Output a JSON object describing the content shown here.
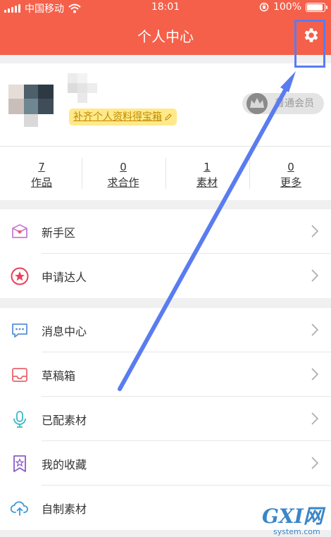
{
  "status_bar": {
    "carrier": "中国移动",
    "time": "18:01",
    "battery": "100%",
    "battery_level": 1.0
  },
  "nav": {
    "title": "个人中心"
  },
  "profile": {
    "promo_text": "补齐个人资料得宝箱",
    "member_label": "普通会员"
  },
  "stats": [
    {
      "num": "7",
      "label": "作品"
    },
    {
      "num": "0",
      "label": "求合作"
    },
    {
      "num": "1",
      "label": "素材"
    },
    {
      "num": "0",
      "label": "更多"
    }
  ],
  "menu": {
    "group1": [
      {
        "label": "新手区",
        "icon": "gift-box-icon"
      },
      {
        "label": "申请达人",
        "icon": "star-badge-icon"
      }
    ],
    "group2": [
      {
        "label": "消息中心",
        "icon": "chat-bubble-icon"
      },
      {
        "label": "草稿箱",
        "icon": "inbox-icon"
      },
      {
        "label": "已配素材",
        "icon": "microphone-icon"
      },
      {
        "label": "我的收藏",
        "icon": "bookmark-star-icon"
      },
      {
        "label": "自制素材",
        "icon": "cloud-upload-icon"
      }
    ]
  },
  "watermark": {
    "text": "GXI网",
    "sub": "system.com"
  },
  "colors": {
    "header": "#f5604a",
    "annotation": "#5a7cf0",
    "promo_bg": "#ffe98a"
  }
}
